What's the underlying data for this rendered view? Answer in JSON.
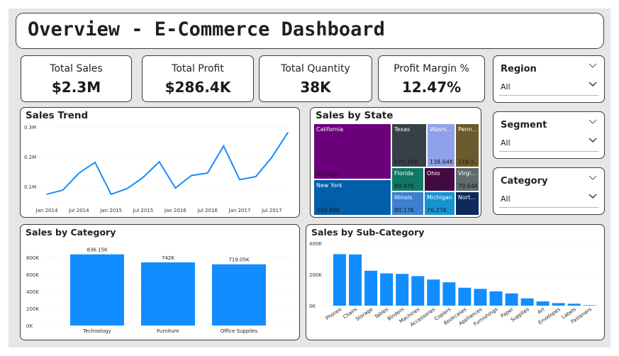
{
  "title": "Overview - E-Commerce Dashboard",
  "kpis": [
    {
      "label": "Total Sales",
      "value": "$2.3M"
    },
    {
      "label": "Total Profit",
      "value": "$286.4K"
    },
    {
      "label": "Total Quantity",
      "value": "38K"
    },
    {
      "label": "Profit Margin %",
      "value": "12.47%"
    }
  ],
  "slicers": [
    {
      "label": "Region",
      "value": "All"
    },
    {
      "label": "Segment",
      "value": "All"
    },
    {
      "label": "Category",
      "value": "All"
    }
  ],
  "panels": {
    "sales_trend": "Sales Trend",
    "sales_by_state": "Sales by State",
    "sales_by_category": "Sales by Category",
    "sales_by_subcategory": "Sales by Sub-Category"
  },
  "colors": {
    "accent": "#118dff",
    "border": "#3b3b3b",
    "background": "#e6e6e6"
  },
  "icons": {
    "dropdown": "chevron-down-icon"
  },
  "treemap": [
    {
      "name": "California",
      "value": "457.69K",
      "color": "#6b007b"
    },
    {
      "name": "New York",
      "value": "310.88K",
      "color": "#005fa8"
    },
    {
      "name": "Texas",
      "value": "170.19K",
      "color": "#373f47"
    },
    {
      "name": "Washi...",
      "value": "138.64K",
      "color": "#8ea1ea"
    },
    {
      "name": "Penn...",
      "value": "116.5...",
      "color": "#6b5a2c"
    },
    {
      "name": "Florida",
      "value": "89.47K",
      "color": "#117865"
    },
    {
      "name": "Ohio",
      "value": "78.26K",
      "color": "#430a44"
    },
    {
      "name": "Virgi...",
      "value": "70.64K",
      "color": "#5f6b6d"
    },
    {
      "name": "Illinois",
      "value": "80.17K",
      "color": "#3d80d1"
    },
    {
      "name": "Michigan",
      "value": "76.27K",
      "color": "#1793d2"
    },
    {
      "name": "Nort...",
      "value": "",
      "color": "#0c2a5a"
    }
  ],
  "chart_data": [
    {
      "type": "line",
      "title": "Sales Trend",
      "x": [
        "2014-01",
        "2014-04",
        "2014-07",
        "2014-10",
        "2015-01",
        "2015-04",
        "2015-07",
        "2015-10",
        "2016-01",
        "2016-04",
        "2016-07",
        "2016-10",
        "2017-01",
        "2017-04",
        "2017-07",
        "2017-10"
      ],
      "x_ticks": [
        "Jan 2014",
        "Jul 2014",
        "Jan 2015",
        "Jul 2015",
        "Jan 2016",
        "Jul 2016",
        "Jan 2017",
        "Jul 2017"
      ],
      "y_ticks": [
        "0.1M",
        "0.2M",
        "0.3M"
      ],
      "ylim": [
        0.05,
        0.3
      ],
      "values": [
        0.074,
        0.088,
        0.145,
        0.181,
        0.074,
        0.093,
        0.131,
        0.183,
        0.095,
        0.137,
        0.145,
        0.236,
        0.123,
        0.133,
        0.198,
        0.281
      ],
      "color": "#118dff"
    },
    {
      "type": "bar",
      "title": "Sales by Category",
      "categories": [
        "Technology",
        "Furniture",
        "Office Supplies"
      ],
      "values": [
        836150,
        742000,
        719050
      ],
      "data_labels": [
        "836.15K",
        "742K",
        "719.05K"
      ],
      "y_ticks": [
        "0K",
        "200K",
        "400K",
        "600K",
        "800K"
      ],
      "ylim": [
        0,
        900000
      ],
      "color": "#118dff"
    },
    {
      "type": "bar",
      "title": "Sales by Sub-Category",
      "categories": [
        "Phones",
        "Chairs",
        "Storage",
        "Tables",
        "Binders",
        "Machines",
        "Accessories",
        "Copiers",
        "Bookcases",
        "Appliances",
        "Furnishings",
        "Paper",
        "Supplies",
        "Art",
        "Envelopes",
        "Labels",
        "Fasteners"
      ],
      "values": [
        330007,
        328449,
        223844,
        206966,
        203413,
        189239,
        167380,
        149528,
        114880,
        107532,
        91705,
        78479,
        46674,
        27119,
        16476,
        12486,
        3024
      ],
      "y_ticks": [
        "0K",
        "200K",
        "400K"
      ],
      "ylim": [
        0,
        400000
      ],
      "color": "#118dff"
    },
    {
      "type": "treemap",
      "title": "Sales by State",
      "categories": [
        "California",
        "New York",
        "Texas",
        "Washington",
        "Pennsylvania",
        "Florida",
        "Ohio",
        "Virginia",
        "Illinois",
        "Michigan",
        "North Carolina"
      ],
      "values": [
        457690,
        310880,
        170190,
        138640,
        116500,
        89470,
        78260,
        70640,
        80170,
        76270,
        55600
      ]
    }
  ]
}
